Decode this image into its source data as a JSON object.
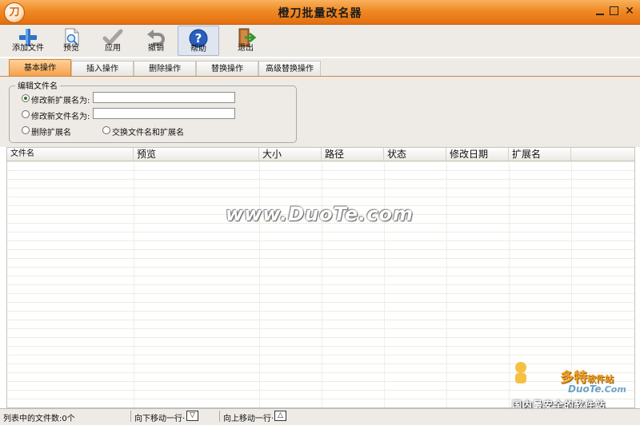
{
  "window": {
    "title": "橙刀批量改名器",
    "logo_text": "刀"
  },
  "toolbar": {
    "items": [
      {
        "label": "添加文件",
        "icon": "plus-icon"
      },
      {
        "label": "预览",
        "icon": "preview-document-icon"
      },
      {
        "label": "应用",
        "icon": "checkmark-icon"
      },
      {
        "label": "撤销",
        "icon": "undo-arrow-icon"
      },
      {
        "label": "帮助",
        "icon": "help-question-icon"
      },
      {
        "label": "退出",
        "icon": "exit-door-icon"
      }
    ]
  },
  "tabs": [
    {
      "label": "基本操作",
      "active": true
    },
    {
      "label": "插入操作",
      "active": false
    },
    {
      "label": "删除操作",
      "active": false
    },
    {
      "label": "替换操作",
      "active": false
    },
    {
      "label": "高级替换操作",
      "active": false
    }
  ],
  "panel": {
    "group_title": "编辑文件名",
    "options": [
      {
        "label": "修改新扩展名为:",
        "selected": true,
        "value": ""
      },
      {
        "label": "修改新文件名为:",
        "selected": false,
        "value": ""
      },
      {
        "label": "删除扩展名",
        "selected": false
      },
      {
        "label": "交换文件名和扩展名",
        "selected": false
      }
    ]
  },
  "file_list": {
    "columns": [
      "文件名",
      "预览",
      "大小",
      "路径",
      "状态",
      "修改日期",
      "扩展名"
    ],
    "rows": []
  },
  "watermark": "www.DuoTe.com",
  "corner_logo": {
    "brand": "多特",
    "brand_suffix": "软件站",
    "site": "DuoTe",
    "site_suffix": ".Com",
    "slogan": "国内最安全的软件站"
  },
  "status_bar": {
    "file_count": "列表中的文件数:0个",
    "move_down": "向下移动一行·",
    "move_down_symbol": "▽",
    "move_up": "向上移动一行·",
    "move_up_symbol": "△"
  },
  "colors": {
    "title_bar": "#f08a24",
    "active_tab": "#f5a24a",
    "panel_bg": "#eeebe6"
  }
}
